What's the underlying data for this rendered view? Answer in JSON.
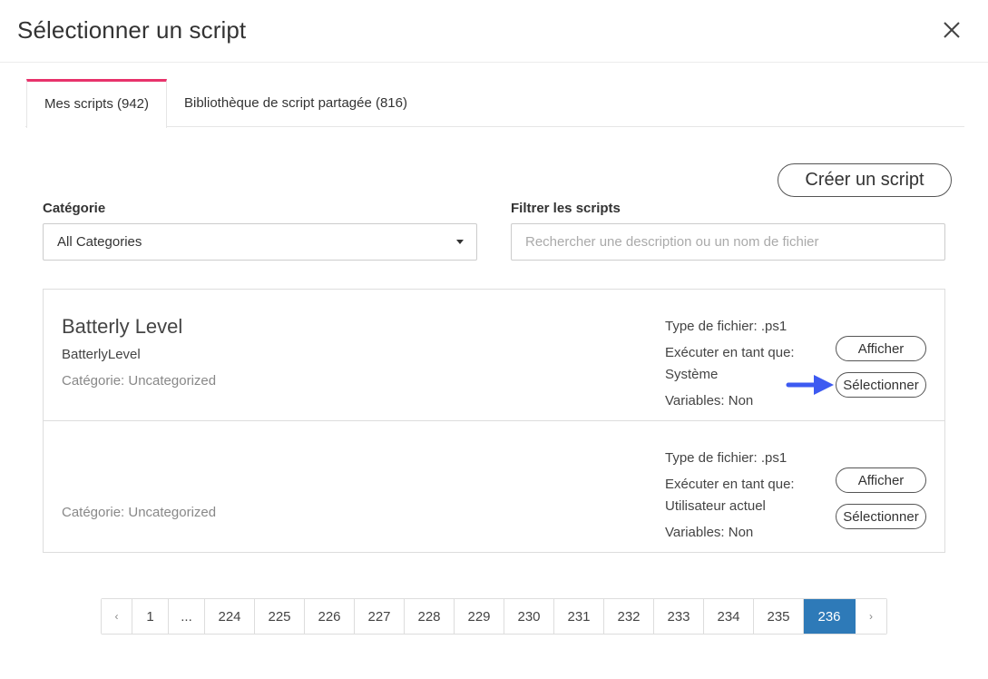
{
  "dialog": {
    "title": "Sélectionner un script",
    "close_icon": "close-icon"
  },
  "tabs": [
    {
      "label": "Mes scripts (942)",
      "active": true
    },
    {
      "label": "Bibliothèque de script partagée (816)",
      "active": false
    }
  ],
  "toolbar": {
    "create_label": "Créer un script"
  },
  "filters": {
    "category_label": "Catégorie",
    "category_value": "All Categories",
    "filter_label": "Filtrer les scripts",
    "search_placeholder": "Rechercher une description ou un nom de fichier",
    "search_value": ""
  },
  "scripts": [
    {
      "name": "Batterly Level",
      "filename": "BatterlyLevel",
      "category": "Catégorie: Uncategorized",
      "file_type": "Type de fichier: .ps1",
      "run_as_label": "Exécuter en tant que:",
      "run_as_value": "Système",
      "variables": "Variables: Non",
      "view_label": "Afficher",
      "select_label": "Sélectionner"
    },
    {
      "name": "",
      "filename": "",
      "category": "Catégorie: Uncategorized",
      "file_type": "Type de fichier: .ps1",
      "run_as_label": "Exécuter en tant que:",
      "run_as_value": "Utilisateur actuel",
      "variables": "Variables: Non",
      "view_label": "Afficher",
      "select_label": "Sélectionner"
    }
  ],
  "pagination": {
    "prev": "‹",
    "first": "1",
    "ellipsis": "...",
    "pages": [
      "224",
      "225",
      "226",
      "227",
      "228",
      "229",
      "230",
      "231",
      "232",
      "233",
      "234",
      "235"
    ],
    "current": "236",
    "next": "›"
  },
  "colors": {
    "accent_tab": "#e8326b",
    "current_page": "#2e7ab8",
    "annotation_arrow": "#3d5af1"
  }
}
